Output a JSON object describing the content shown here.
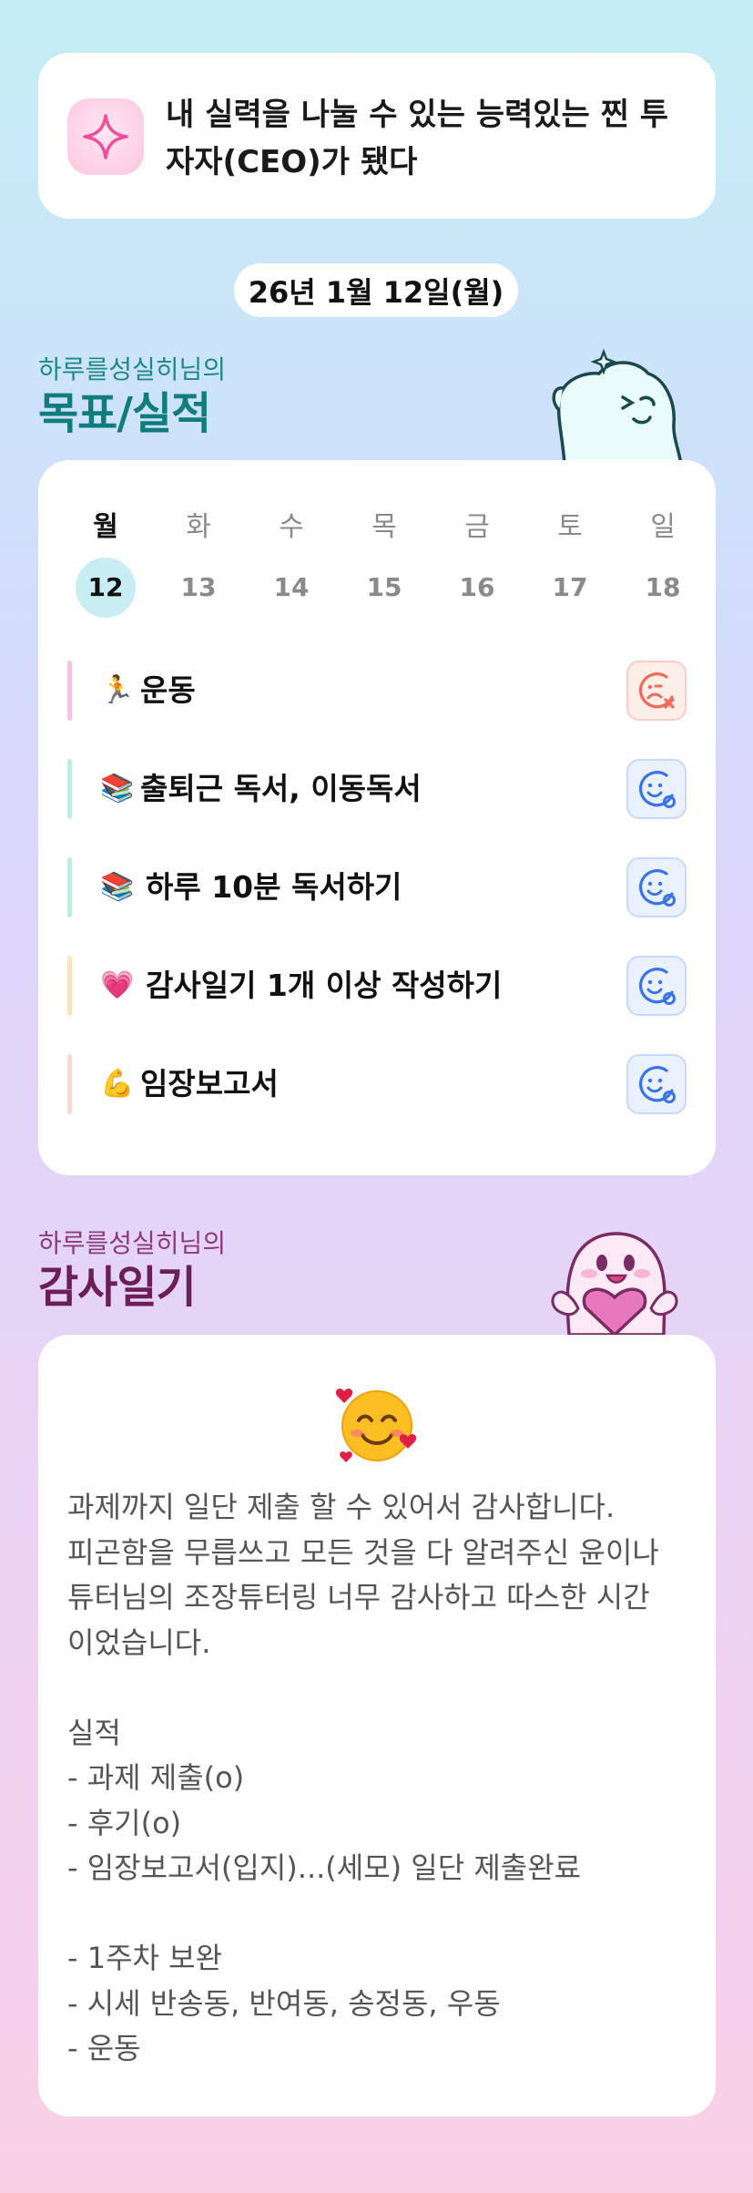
{
  "goal": {
    "text": "내 실력을 나눌 수 있는 능력있는 찐 투자자(CEO)가 됐다",
    "icon": "sparkle-icon"
  },
  "date_label": "26년 1월 12일(월)",
  "goals_section": {
    "subtitle": "하루를성실히님의",
    "title": "목표/실적",
    "weekdays": [
      "월",
      "화",
      "수",
      "목",
      "금",
      "토",
      "일"
    ],
    "days": [
      "12",
      "13",
      "14",
      "15",
      "16",
      "17",
      "18"
    ],
    "selected_index": 0,
    "items": [
      {
        "emoji": "🏃",
        "label": "운동",
        "status": "fail",
        "bar_color": "#f6c4e0"
      },
      {
        "emoji": "📚",
        "label": "출퇴근 독서, 이동독서",
        "status": "ok",
        "bar_color": "#bfeede"
      },
      {
        "emoji": "📚",
        "label": "하루 10분 독서하기",
        "status": "ok",
        "bar_color": "#bfeede"
      },
      {
        "emoji": "💗",
        "label": "감사일기 1개 이상 작성하기",
        "status": "ok",
        "bar_color": "#fbe2c0"
      },
      {
        "emoji": "💪",
        "label": "임장보고서",
        "status": "ok",
        "bar_color": "#fad9d6"
      }
    ]
  },
  "gratitude_section": {
    "subtitle": "하루를성실히님의",
    "title": "감사일기",
    "emoji": "smiling-face-with-hearts-icon",
    "body": "과제까지 일단 제출 할 수 있어서 감사합니다.\n피곤함을 무릅쓰고 모든 것을 다 알려주신 윤이나\n튜터님의 조장튜터링 너무 감사하고 따스한 시간\n이었습니다.\n\n실적\n- 과제 제출(o)\n- 후기(o)\n- 임장보고서(입지)...(세모) 일단 제출완료\n\n- 1주차 보완\n- 시세 반송동, 반여동, 송정동, 우동\n- 운동"
  },
  "colors": {
    "fail": "#f06a57",
    "ok": "#3a73e8",
    "teal": "#0f7d7d",
    "plum": "#6b1f58"
  }
}
